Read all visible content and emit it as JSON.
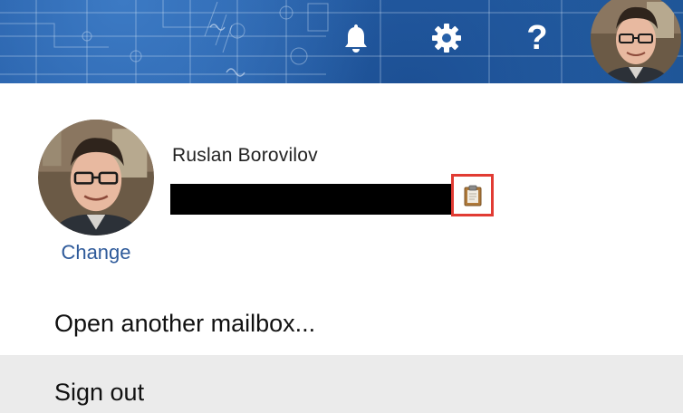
{
  "header": {
    "notifications_icon": "bell-icon",
    "settings_icon": "gear-icon",
    "help_glyph": "?",
    "colors": {
      "banner": "#2660a9",
      "icon": "#ffffff"
    }
  },
  "profile": {
    "name": "Ruslan Borovilov",
    "change_label": "Change",
    "copy_icon": "clipboard-icon",
    "highlight_color": "#e13b33",
    "link_color": "#2e5a9a"
  },
  "menu": {
    "open_mailbox_label": "Open another mailbox...",
    "sign_out_label": "Sign out"
  }
}
